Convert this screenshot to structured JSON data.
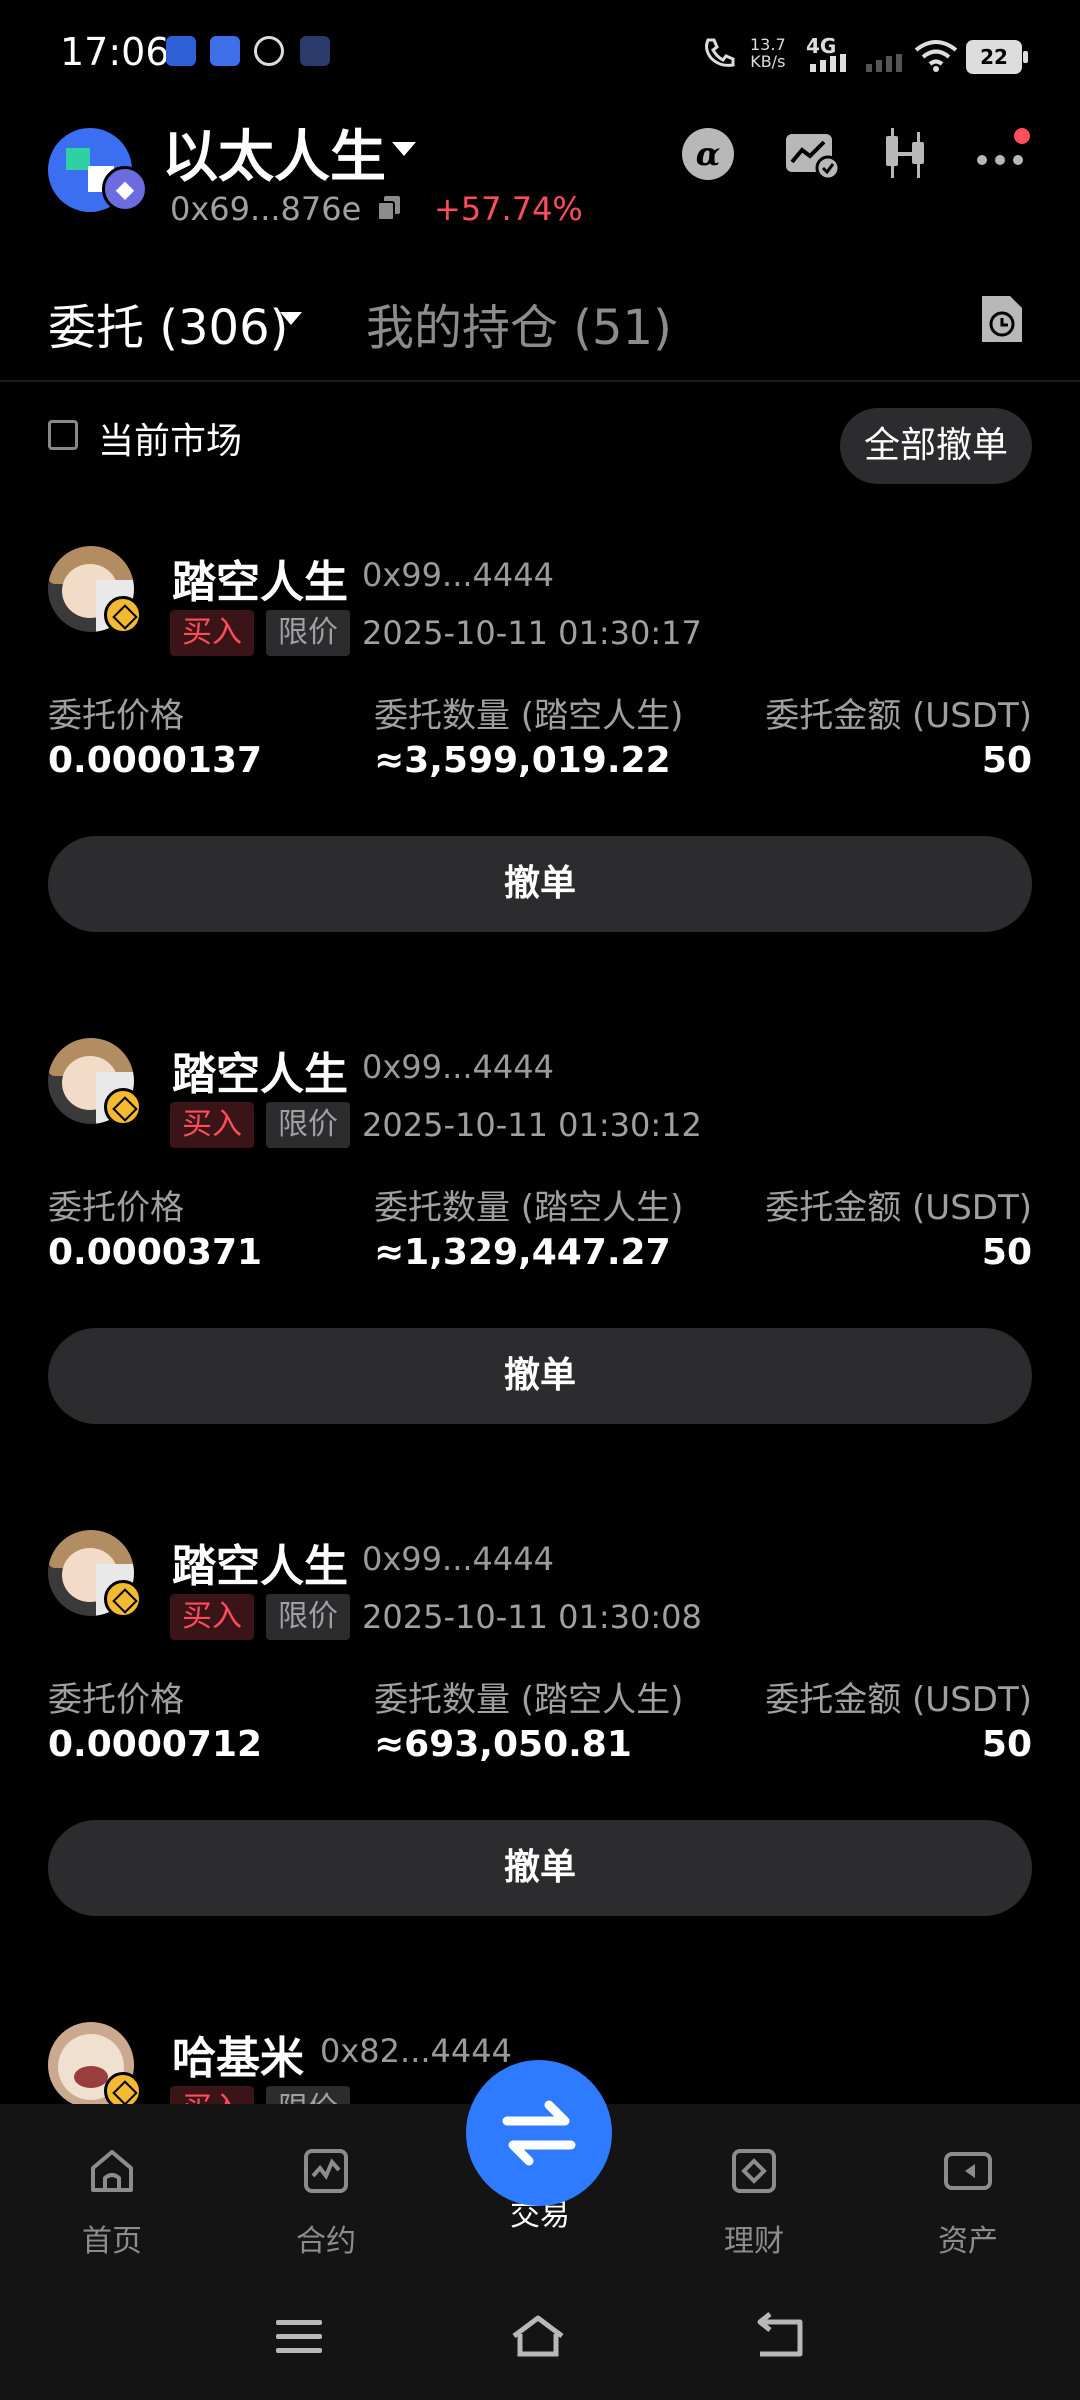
{
  "status_bar": {
    "time": "17:06",
    "net_speed_value": "13.7",
    "net_speed_unit": "KB/s",
    "network": "4G",
    "battery": "22"
  },
  "wallet": {
    "name": "以太人生",
    "address": "0x69...876e",
    "change": "+57.74%",
    "change_color": "#ff4d5c"
  },
  "tabs": {
    "orders_label": "委托 (306)",
    "holdings_label": "我的持仓 (51)"
  },
  "filter": {
    "current_market_label": "当前市场",
    "cancel_all_label": "全部撤单"
  },
  "labels": {
    "price": "委托价格",
    "amount_prefix": "委托数量",
    "total": "委托金额 (USDT)",
    "buy": "买入",
    "limit": "限价",
    "cancel": "撤单"
  },
  "orders": [
    {
      "token": "踏空人生",
      "address": "0x99...4444",
      "side": "买入",
      "type": "限价",
      "time": "2025-10-11 01:30:17",
      "price": "0.0000137",
      "amount_label": "委托数量 (踏空人生)",
      "amount": "≈3,599,019.22",
      "total": "50"
    },
    {
      "token": "踏空人生",
      "address": "0x99...4444",
      "side": "买入",
      "type": "限价",
      "time": "2025-10-11 01:30:12",
      "price": "0.0000371",
      "amount_label": "委托数量 (踏空人生)",
      "amount": "≈1,329,447.27",
      "total": "50"
    },
    {
      "token": "踏空人生",
      "address": "0x99...4444",
      "side": "买入",
      "type": "限价",
      "time": "2025-10-11 01:30:08",
      "price": "0.0000712",
      "amount_label": "委托数量 (踏空人生)",
      "amount": "≈693,050.81",
      "total": "50"
    },
    {
      "token": "哈基米",
      "address": "0x82...4444"
    }
  ],
  "nav": {
    "home": "首页",
    "contract": "合约",
    "trade": "交易",
    "finance": "理财",
    "assets": "资产"
  },
  "icons": {
    "header": [
      "alpha-icon",
      "chart-check-icon",
      "candlestick-icon",
      "more-icon"
    ],
    "accent": "#2f7bff"
  }
}
